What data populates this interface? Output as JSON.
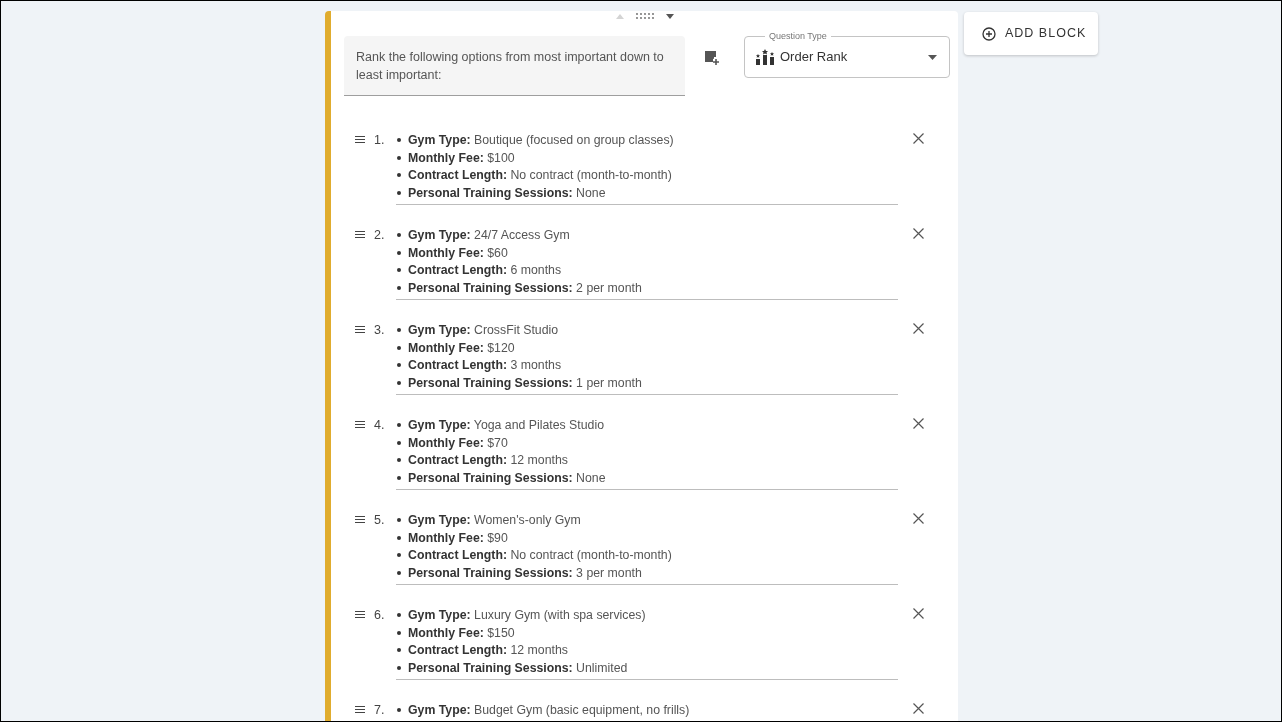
{
  "question": {
    "prompt": "Rank the following options from most important down to least important:",
    "type_label": "Question Type",
    "type_value": "Order Rank"
  },
  "options": [
    {
      "number": "1.",
      "lines": [
        "**Gym Type:** Boutique (focused on group classes)",
        "**Monthly Fee:** $100",
        "**Contract Length:** No contract (month-to-month)",
        "**Personal Training Sessions:** None"
      ]
    },
    {
      "number": "2.",
      "lines": [
        "**Gym Type:** 24/7 Access Gym",
        "**Monthly Fee:** $60",
        "**Contract Length:** 6 months",
        "**Personal Training Sessions:** 2 per month"
      ]
    },
    {
      "number": "3.",
      "lines": [
        "**Gym Type:** CrossFit Studio",
        "**Monthly Fee:** $120",
        "**Contract Length:** 3 months",
        "**Personal Training Sessions:** 1 per month"
      ]
    },
    {
      "number": "4.",
      "lines": [
        "**Gym Type:** Yoga and Pilates Studio",
        "**Monthly Fee:** $70",
        "**Contract Length:** 12 months",
        "**Personal Training Sessions:** None"
      ]
    },
    {
      "number": "5.",
      "lines": [
        "**Gym Type:** Women's-only Gym",
        "**Monthly Fee:** $90",
        "**Contract Length:** No contract (month-to-month)",
        "**Personal Training Sessions:** 3 per month"
      ]
    },
    {
      "number": "6.",
      "lines": [
        "**Gym Type:** Luxury Gym (with spa services)",
        "**Monthly Fee:** $150",
        "**Contract Length:** 12 months",
        "**Personal Training Sessions:** Unlimited"
      ]
    },
    {
      "number": "7.",
      "lines": [
        "**Gym Type:** Budget Gym (basic equipment, no frills)"
      ]
    }
  ],
  "add_block": "ADD BLOCK"
}
